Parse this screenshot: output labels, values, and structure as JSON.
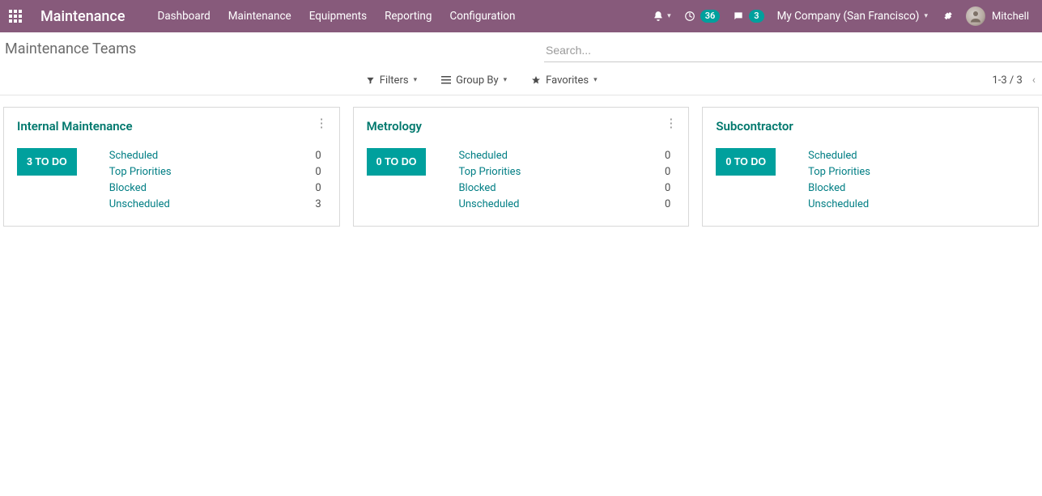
{
  "nav": {
    "brand": "Maintenance",
    "menu": [
      "Dashboard",
      "Maintenance",
      "Equipments",
      "Reporting",
      "Configuration"
    ],
    "activity_count": "36",
    "discuss_count": "3",
    "company": "My Company (San Francisco)",
    "user_name": "Mitchell"
  },
  "control": {
    "title": "Maintenance Teams",
    "search_placeholder": "Search...",
    "filters_label": "Filters",
    "groupby_label": "Group By",
    "favorites_label": "Favorites",
    "pager": "1-3 / 3"
  },
  "stat_labels": {
    "scheduled": "Scheduled",
    "top_priorities": "Top Priorities",
    "blocked": "Blocked",
    "unscheduled": "Unscheduled"
  },
  "cards": [
    {
      "title": "Internal Maintenance",
      "todo": "3 TO DO",
      "scheduled": "0",
      "top_priorities": "0",
      "blocked": "0",
      "unscheduled": "3",
      "show_counts": true,
      "show_more": true
    },
    {
      "title": "Metrology",
      "todo": "0 TO DO",
      "scheduled": "0",
      "top_priorities": "0",
      "blocked": "0",
      "unscheduled": "0",
      "show_counts": true,
      "show_more": true
    },
    {
      "title": "Subcontractor",
      "todo": "0 TO DO",
      "scheduled": "",
      "top_priorities": "",
      "blocked": "",
      "unscheduled": "",
      "show_counts": false,
      "show_more": false
    }
  ]
}
